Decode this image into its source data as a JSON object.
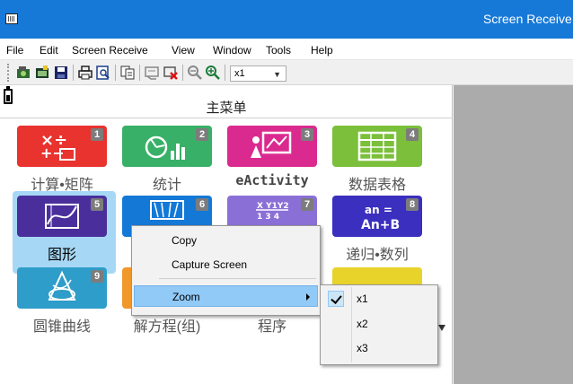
{
  "window": {
    "title": "Screen Receive"
  },
  "menubar": {
    "items": [
      "File",
      "Edit",
      "Screen Receive",
      "View",
      "Window",
      "Tools",
      "Help"
    ]
  },
  "toolbar": {
    "buttons": [
      "open-capture-icon",
      "new-window-icon",
      "save-icon",
      "print-icon",
      "print-preview-icon",
      "copy-icon",
      "receive-icon",
      "stop-receive-icon",
      "zoom-out-icon",
      "zoom-in-icon"
    ],
    "zoom_value": "x1"
  },
  "main": {
    "heading": "主菜单"
  },
  "apps": [
    {
      "number": "1",
      "label": "计算•矩阵",
      "color": "#e8332f",
      "icon": "calculation-matrix-icon"
    },
    {
      "number": "2",
      "label": "统计",
      "color": "#38b067",
      "icon": "statistics-icon"
    },
    {
      "number": "3",
      "label": "eActivity",
      "color": "#db2a8f",
      "icon": "eactivity-icon"
    },
    {
      "number": "4",
      "label": "数据表格",
      "color": "#7bbf3a",
      "icon": "spreadsheet-icon"
    },
    {
      "number": "5",
      "label": "图形",
      "color": "#4a2f9c",
      "icon": "graph-icon"
    },
    {
      "number": "6",
      "label": "",
      "color": "#1479d6",
      "icon": "dyna-graph-icon"
    },
    {
      "number": "7",
      "label": "",
      "color": "#8a6fd6",
      "icon": "table-icon",
      "icon_text": "X Y1Y2 / 1 3 4"
    },
    {
      "number": "8",
      "label": "递归•数列",
      "color": "#3b2fbf",
      "icon": "recursion-icon",
      "icon_text": "an= An+B"
    },
    {
      "number": "9",
      "label": "圆锥曲线",
      "color": "#2e9dc9",
      "icon": "conics-icon"
    },
    {
      "number": "",
      "label": "解方程(组)",
      "color": "#f0982b",
      "icon": "equation-icon"
    },
    {
      "number": "",
      "label": "程序",
      "color": "#7a7a7a",
      "icon": "program-icon"
    },
    {
      "number": "",
      "label": "",
      "color": "#e8d32b",
      "icon": "financial-icon"
    }
  ],
  "context_menu": {
    "items": [
      {
        "label": "Copy"
      },
      {
        "label": "Capture Screen"
      },
      {
        "label": "Zoom"
      }
    ]
  },
  "zoom_submenu": {
    "items": [
      {
        "label": "x1",
        "checked": true
      },
      {
        "label": "x2",
        "checked": false
      },
      {
        "label": "x3",
        "checked": false
      }
    ]
  }
}
